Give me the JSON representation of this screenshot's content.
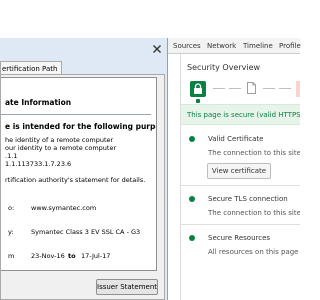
{
  "devtools": {
    "tabs": [
      "Sources",
      "Network",
      "Timeline",
      "Profile"
    ],
    "security": {
      "title": "Security Overview",
      "secure_message": "This page is secure (valid HTTPS).",
      "sections": [
        {
          "heading": "Valid Certificate",
          "description": "The connection to this site is using",
          "button": "View certificate"
        },
        {
          "heading": "Secure TLS connection",
          "description": "The connection to this site is using"
        },
        {
          "heading": "Secure Resources",
          "description": "All resources on this page are serve"
        }
      ],
      "colors": {
        "secure": "#0b8043",
        "secure_bg": "#e6f4ea",
        "insecure": "#f8d3d0"
      }
    }
  },
  "certificate_dialog": {
    "tab_label": "ertification Path",
    "info_title": "ate Information",
    "intended_heading": "e is intended for the following purpose(s):",
    "purposes": [
      "he identity of a remote computer",
      "our identity to a remote computer",
      ".1.1",
      "1.1.113733.1.7.23.6"
    ],
    "authority_note": "rtification authority's statement for details.",
    "issued_to_label": "o:",
    "issued_to_value": "www.symantec.com",
    "issued_by_label": "y:",
    "issued_by_value": "Symantec Class 3 EV SSL CA - G3",
    "valid_from_label": "m",
    "valid_from_value": "23-Nov-16",
    "valid_to_label": "to",
    "valid_to_value": "17-Jul-17",
    "issuer_button": "Issuer Statement"
  }
}
